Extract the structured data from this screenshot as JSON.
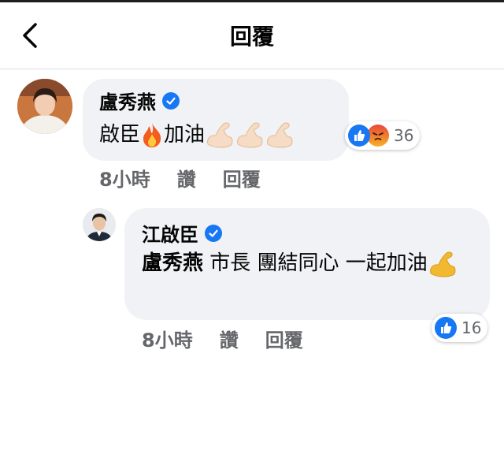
{
  "header": {
    "title": "回覆"
  },
  "comments": [
    {
      "author": "盧秀燕",
      "text_before": "啟臣",
      "text_after": "加油",
      "reaction_count": "36",
      "time": "8小時",
      "like_label": "讚",
      "reply_label": "回覆"
    },
    {
      "author": "江啟臣",
      "mention": "盧秀燕",
      "text": " 市長 團結同心 一起加油",
      "reaction_count": "16",
      "time": "8小時",
      "like_label": "讚",
      "reply_label": "回覆"
    }
  ],
  "colors": {
    "accent": "#1877f2",
    "bubble": "#f0f2f5",
    "meta": "#65676b"
  },
  "icons": [
    "back-arrow-icon",
    "verified-badge-icon",
    "fire-emoji-icon",
    "flexed-biceps-emoji-icon",
    "like-reaction-icon",
    "angry-reaction-icon"
  ]
}
